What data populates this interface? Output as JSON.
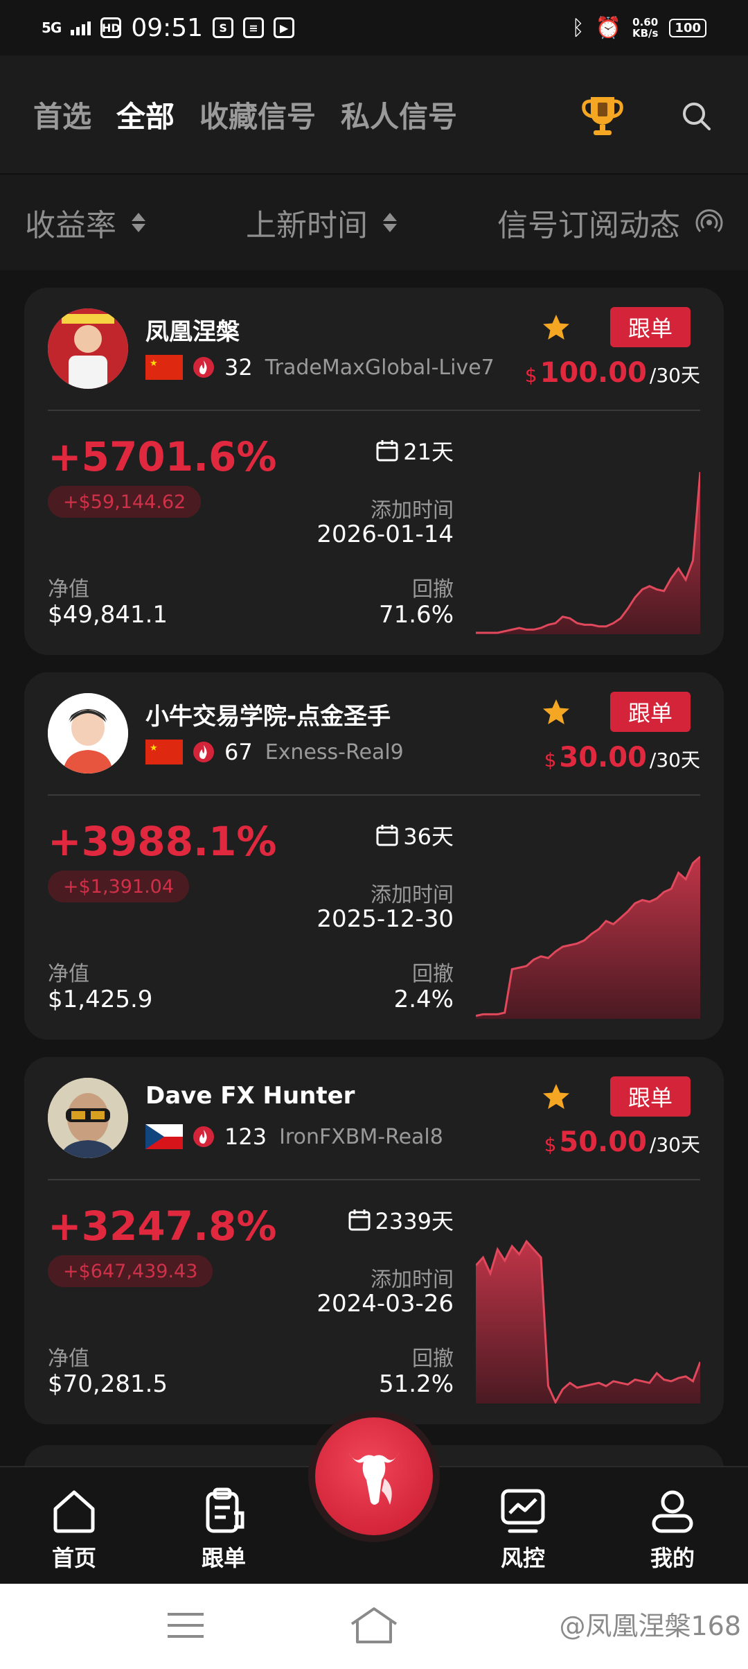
{
  "status_bar": {
    "time": "09:51",
    "network": "5G",
    "speed": "0.60",
    "speed_unit": "KB/s",
    "battery": "100"
  },
  "top_tabs": [
    "首选",
    "全部",
    "收藏信号",
    "私人信号"
  ],
  "active_tab": "全部",
  "sort_bar": {
    "roi": "收益率",
    "newest": "上新时间",
    "subscription": "信号订阅动态"
  },
  "labels": {
    "follow": "跟单",
    "per_period": "/30天",
    "currency": "$",
    "added_time": "添加时间",
    "equity": "净值",
    "drawdown": "回撤"
  },
  "signals": [
    {
      "name": "凤凰涅槃",
      "country": "china",
      "heat": "32",
      "server": "TradeMaxGlobal-Live7",
      "price": "100.00",
      "roi": "+5701.6%",
      "profit": "+$59,144.62",
      "days": "21天",
      "added_date": "2026-01-14",
      "equity": "$49,841.1",
      "drawdown": "71.6%",
      "curve": [
        0,
        0,
        0,
        0,
        0.01,
        0.02,
        0.03,
        0.02,
        0.02,
        0.03,
        0.05,
        0.06,
        0.1,
        0.09,
        0.06,
        0.05,
        0.05,
        0.04,
        0.04,
        0.06,
        0.09,
        0.15,
        0.22,
        0.27,
        0.29,
        0.27,
        0.26,
        0.34,
        0.4,
        0.33,
        0.45,
        1.0
      ]
    },
    {
      "name": "小牛交易学院-点金圣手",
      "country": "china",
      "heat": "67",
      "server": "Exness-Real9",
      "price": "30.00",
      "roi": "+3988.1%",
      "profit": "+$1,391.04",
      "days": "36天",
      "added_date": "2025-12-30",
      "equity": "$1,425.9",
      "drawdown": "2.4%",
      "curve": [
        0.01,
        0.02,
        0.02,
        0.02,
        0.03,
        0.3,
        0.31,
        0.32,
        0.36,
        0.38,
        0.37,
        0.41,
        0.44,
        0.45,
        0.46,
        0.48,
        0.52,
        0.55,
        0.6,
        0.58,
        0.62,
        0.66,
        0.71,
        0.73,
        0.72,
        0.74,
        0.78,
        0.8,
        0.9,
        0.86,
        0.96,
        1.0
      ]
    },
    {
      "name": "Dave FX Hunter",
      "country": "czech",
      "heat": "123",
      "server": "IronFXBM-Real8",
      "price": "50.00",
      "roi": "+3247.8%",
      "profit": "+$647,439.43",
      "days": "2339天",
      "added_date": "2024-03-26",
      "equity": "$70,281.5",
      "drawdown": "51.2%",
      "curve": [
        0.85,
        0.9,
        0.8,
        0.95,
        0.88,
        0.97,
        0.92,
        1.0,
        0.95,
        0.9,
        0.1,
        0.0,
        0.08,
        0.12,
        0.09,
        0.1,
        0.11,
        0.12,
        0.1,
        0.13,
        0.12,
        0.11,
        0.14,
        0.13,
        0.12,
        0.18,
        0.14,
        0.13,
        0.15,
        0.16,
        0.13,
        0.25
      ]
    }
  ],
  "bottom_nav": [
    "首页",
    "跟单",
    "风控",
    "我的"
  ],
  "watermark": "@凤凰涅槃168",
  "colors": {
    "accent": "#e0283e",
    "button": "#d3243a",
    "star": "#f5a623"
  }
}
